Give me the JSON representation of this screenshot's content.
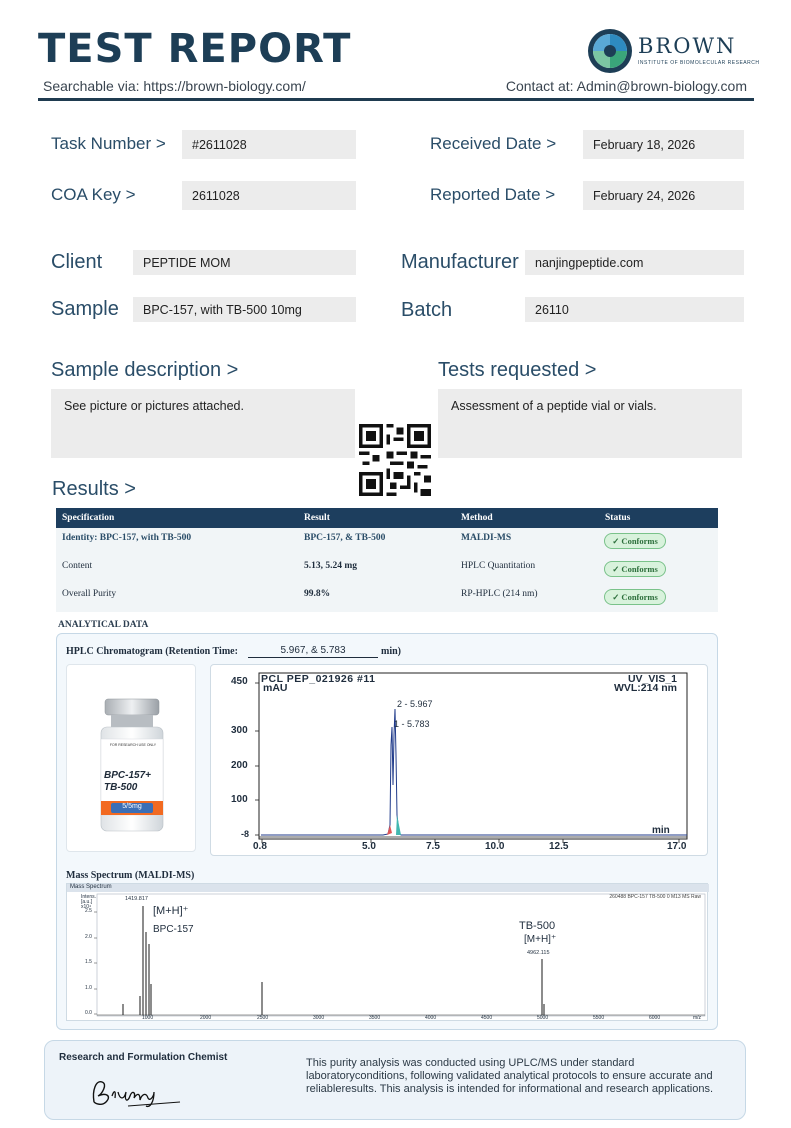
{
  "header": {
    "title": "TEST REPORT",
    "searchable": "Searchable via: https://brown-biology.com/",
    "contact": "Contact at: Admin@brown-biology.com",
    "logo_name": "BROWN",
    "logo_tagline": "INSTITUTE OF BIOMOLECULAR RESEARCH",
    "brand_color": "#1d3e56"
  },
  "info": {
    "task_label": "Task Number  >",
    "task_value": "#2611028",
    "coa_label": "COA  Key >",
    "coa_value": "2611028",
    "received_label": "Received Date  >",
    "received_value": "February 18, 2026",
    "reported_label": "Reported Date >",
    "reported_value": "February 24, 2026",
    "client_label": "Client",
    "client_value": "PEPTIDE MOM",
    "sample_label": "Sample",
    "sample_value": "BPC-157, with TB-500 10mg",
    "manufacturer_label": "Manufacturer",
    "manufacturer_value": "nanjingpeptide.com",
    "batch_label": "Batch",
    "batch_value": "26110"
  },
  "description": {
    "sample_label": "Sample description   >",
    "sample_text": "See picture or pictures attached.",
    "tests_label": "Tests requested   >",
    "tests_text": "Assessment of a peptide vial or vials."
  },
  "results": {
    "label": "Results   >",
    "headers": [
      "Specification",
      "Result",
      "Method",
      "Status"
    ],
    "rows": [
      {
        "spec": "Identity:   BPC-157, with TB-500",
        "result": "BPC-157, & TB-500",
        "method": "MALDI-MS",
        "status": "✓ Conforms"
      },
      {
        "spec": "Content",
        "result": "5.13, 5.24   mg",
        "method": "HPLC Quantitation",
        "status": "✓ Conforms"
      },
      {
        "spec": "Overall Purity",
        "result": "99.8%",
        "method": "RP-HPLC (214 nm)",
        "status": "✓ Conforms"
      }
    ],
    "status_color": "#2d6f3c"
  },
  "analytical": {
    "title": "ANALYTICAL DATA",
    "hplc_title": "HPLC Chromatogram (Retention Time:",
    "retention_values": "5.967, & 5.783",
    "retention_unit": "min)",
    "vial": {
      "line1": "FOR RESEARCH USE ONLY",
      "name1": "BPC-157+",
      "name2": "TB-500",
      "dose": "5/5mg"
    },
    "chrom": {
      "header_left": "PCL PEP_021926 #11",
      "header_right": "UV_VIS_1",
      "wvl": "WVL:214 nm",
      "y_unit": "mAU",
      "x_unit": "min",
      "y_ticks": [
        "450",
        "300",
        "200",
        "100",
        "-8"
      ],
      "x_ticks": [
        "0.8",
        "5.0",
        "7.5",
        "10.0",
        "12.5",
        "17.0"
      ],
      "peak1": "2 - 5.967",
      "peak2": "1 - 5.783"
    },
    "ms_title": "Mass Spectrum (MALDI-MS)",
    "ms": {
      "header": "Mass Spectrum",
      "file": "260488 BPC-157 TB-500 0 M13 MS Raw",
      "y_title1": "Intens.",
      "y_title2": "[a.u.]",
      "y_exp": "x10⁴",
      "peak_mass": "1419.817",
      "mh1": "[M+H]⁺",
      "bpc": "BPC-157",
      "tb": "TB-500",
      "mh2": "[M+H]⁺",
      "tb_mass": "4962.115",
      "y_ticks": [
        "2.5",
        "2.0",
        "1.5",
        "1.0",
        "0.5",
        "0.0"
      ],
      "x_ticks": [
        "1000",
        "2000",
        "2500",
        "3000",
        "3500",
        "4000",
        "4500",
        "5000",
        "5500",
        "6000"
      ],
      "x_unit": "m/z"
    }
  },
  "footer": {
    "chemist": "Research and Formulation Chemist",
    "signature": "Bibang",
    "disclaimer": "This purity analysis was conducted using UPLC/MS under standard laboratoryconditions, following validated analytical protocols to ensure accurate and reliableresults. This analysis is intended for informational and research applications."
  }
}
